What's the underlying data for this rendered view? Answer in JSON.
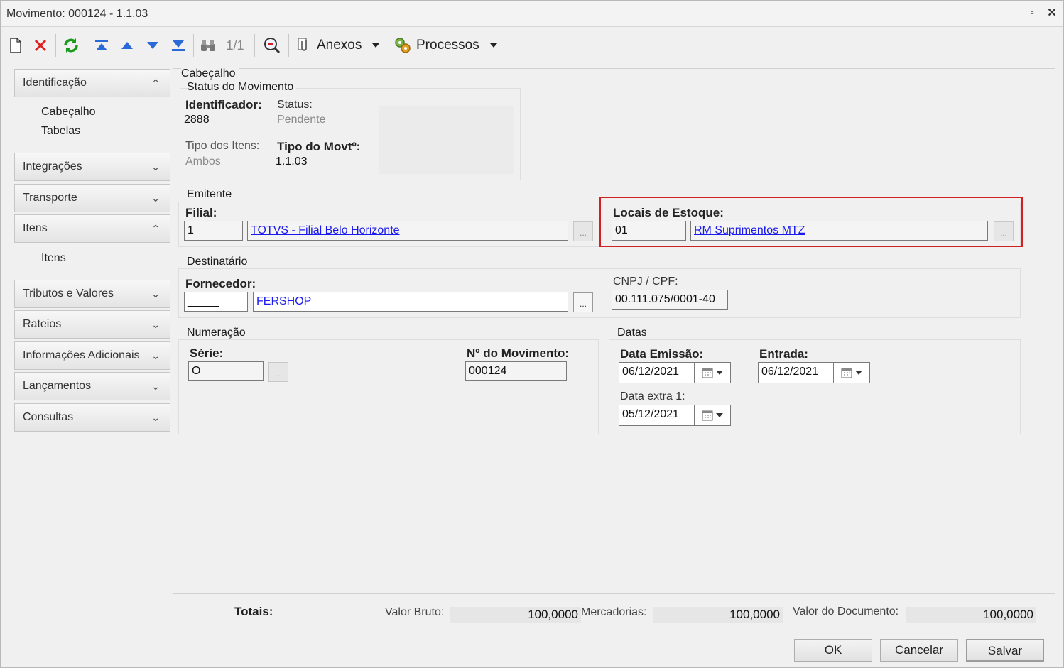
{
  "window": {
    "title": "Movimento: 000124 - 1.1.03"
  },
  "toolbar": {
    "counter": "1/1",
    "anexos": "Anexos",
    "processos": "Processos"
  },
  "sidebar": {
    "sections": [
      {
        "label": "Identificação",
        "expanded": true,
        "items": [
          "Cabeçalho",
          "Tabelas"
        ]
      },
      {
        "label": "Integrações",
        "expanded": false
      },
      {
        "label": "Transporte",
        "expanded": false
      },
      {
        "label": "Itens",
        "expanded": true,
        "items": [
          "Itens"
        ]
      },
      {
        "label": "Tributos e Valores",
        "expanded": false
      },
      {
        "label": "Rateios",
        "expanded": false
      },
      {
        "label": "Informações Adicionais",
        "expanded": false
      },
      {
        "label": "Lançamentos",
        "expanded": false
      },
      {
        "label": "Consultas",
        "expanded": false
      }
    ]
  },
  "cabecalho": {
    "title": "Cabeçalho",
    "status_group": {
      "title": "Status do Movimento",
      "identificador_label": "Identificador:",
      "identificador_value": "2888",
      "status_label": "Status:",
      "status_value": "Pendente",
      "tipo_itens_label": "Tipo dos Itens:",
      "tipo_itens_value": "Ambos",
      "tipo_movto_label": "Tipo do Movtº:",
      "tipo_movto_value": "1.1.03"
    },
    "emitente": {
      "title": "Emitente",
      "filial_label": "Filial:",
      "filial_code": "1",
      "filial_name": "TOTVS - Filial Belo Horizonte",
      "locais_label": "Locais de Estoque:",
      "locais_code": "01",
      "locais_name": "RM Suprimentos MTZ"
    },
    "destinatario": {
      "title": "Destinatário",
      "fornecedor_label": "Fornecedor:",
      "fornecedor_code": "_____",
      "fornecedor_name": "FERSHOP",
      "cnpj_label": "CNPJ / CPF:",
      "cnpj_value": "00.111.075/0001-40"
    },
    "numeracao": {
      "title": "Numeração",
      "serie_label": "Série:",
      "serie_value": "O",
      "numero_label": "Nº do Movimento:",
      "numero_value": "000124"
    },
    "datas": {
      "title": "Datas",
      "emissao_label": "Data Emissão:",
      "emissao_value": "06/12/2021",
      "entrada_label": "Entrada:",
      "entrada_value": "06/12/2021",
      "extra_label": "Data extra 1:",
      "extra_value": "05/12/2021"
    }
  },
  "totals": {
    "label": "Totais:",
    "valor_bruto_label": "Valor Bruto:",
    "valor_bruto_value": "100,0000",
    "mercadorias_label": "Mercadorias:",
    "mercadorias_value": "100,0000",
    "documento_label": "Valor do Documento:",
    "documento_value": "100,0000"
  },
  "buttons": {
    "ok": "OK",
    "cancel": "Cancelar",
    "save": "Salvar"
  },
  "colors": {
    "highlight": "#d21f1f",
    "link": "#1a1aee"
  }
}
